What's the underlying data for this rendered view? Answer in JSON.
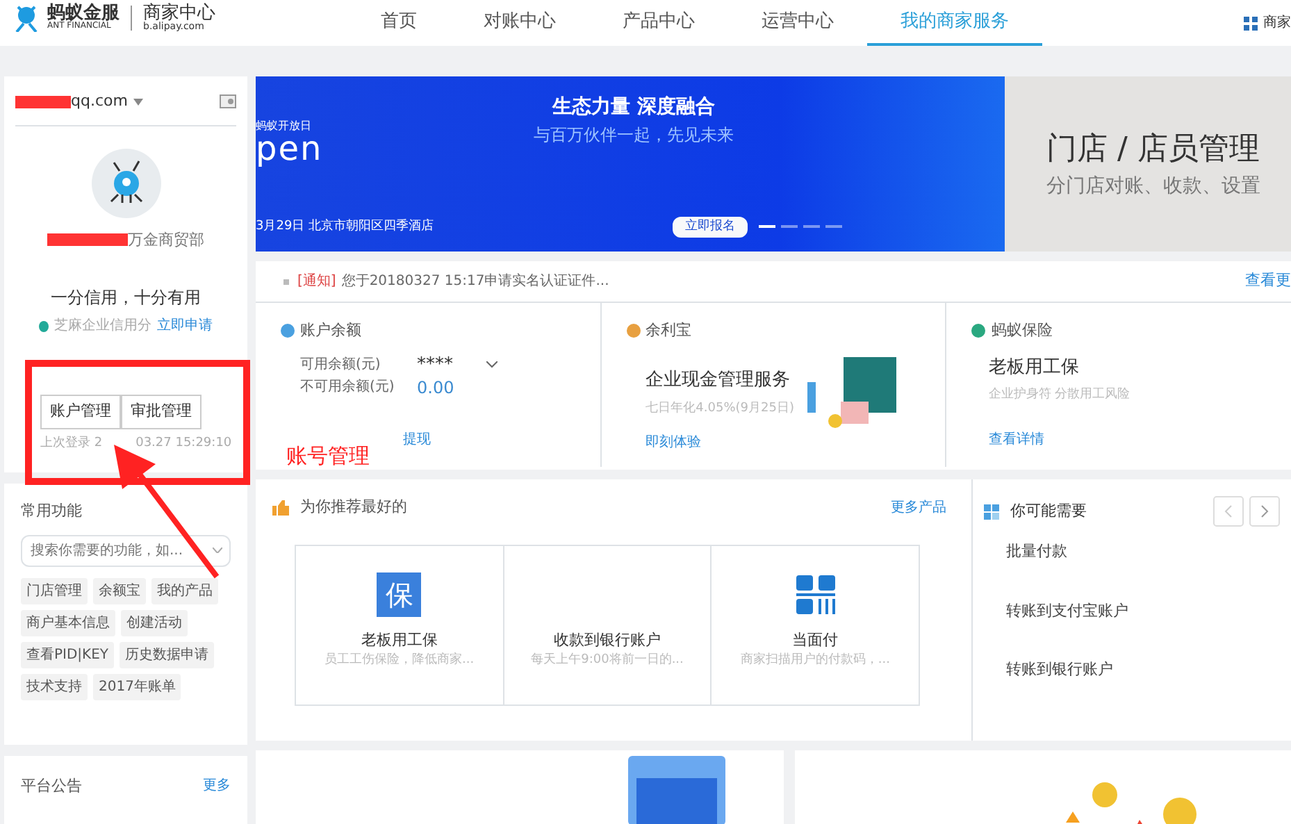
{
  "header": {
    "brand_cn": "蚂蚁金服",
    "brand_en": "ANT FINANCIAL",
    "center_cn": "商家中心",
    "center_url": "b.alipay.com",
    "nav": [
      {
        "label": "首页",
        "selected": false
      },
      {
        "label": "对账中心",
        "selected": false
      },
      {
        "label": "产品中心",
        "selected": false
      },
      {
        "label": "运营中心",
        "selected": false
      },
      {
        "label": "我的商家服务",
        "selected": true
      }
    ],
    "right_label": "商家"
  },
  "account": {
    "email": "qq.com",
    "name": "万金商贸部",
    "slogan": "一分信用，十分有用",
    "credit_label": "芝麻企业信用分",
    "credit_link": "立即申请",
    "buttons": [
      "账户管理",
      "审批管理"
    ],
    "last_login": [
      "上次登录 2",
      "03.27 15:29:10"
    ]
  },
  "functions": {
    "title": "常用功能",
    "placeholder": "搜索你需要的功能，如...",
    "tags": [
      "门店管理",
      "余额宝",
      "我的产品",
      "商户基本信息",
      "创建活动",
      "查看PID|KEY",
      "历史数据申请",
      "技术支持",
      "2017年账单"
    ]
  },
  "announcements": {
    "title": "平台公告",
    "more": "更多"
  },
  "banner": {
    "brand": "蚂蚁开放日",
    "logo": "pen",
    "title": "生态力量 深度融合",
    "subtitle": "与百万伙伴一起，先见未来",
    "venue": "3月29日  北京市朝阳区四季酒店",
    "button": "立即报名",
    "dots": [
      {
        "selected": true
      },
      {
        "selected": false
      },
      {
        "selected": false
      },
      {
        "selected": false
      }
    ]
  },
  "side_banner": {
    "title": "门店 / 店员管理",
    "subtitle": "分门店对账、收款、设置"
  },
  "notice": {
    "tag": "[通知]",
    "text": "您于20180327 15:17申请实名认证证件...",
    "link": "查看更"
  },
  "info_cards": [
    {
      "kind": "balance",
      "title": "账户余额",
      "rows": [
        {
          "label": "可用余额(元)",
          "value": "****"
        },
        {
          "label": "不可用余额(元)",
          "value": "0.00"
        }
      ],
      "link": "提现"
    },
    {
      "kind": "promo",
      "title": "余利宝",
      "heading": "企业现金管理服务",
      "sub": "七日年化4.05%(9月25日)",
      "link": "即刻体验"
    },
    {
      "kind": "insurance",
      "title": "蚂蚁保险",
      "heading": "老板用工保",
      "sub": "企业护身符 分散用工风险",
      "link": "查看详情"
    }
  ],
  "recommend": {
    "title": "为你推荐最好的",
    "more": "更多产品",
    "items": [
      {
        "kind": "char",
        "char": "保",
        "name": "老板用工保",
        "desc": "员工工伤保险，降低商家..."
      },
      {
        "kind": "none",
        "name": "收款到银行账户",
        "desc": "每天上午9:00将前一日的..."
      },
      {
        "kind": "grid",
        "name": "当面付",
        "desc": "商家扫描用户的付款码，..."
      }
    ]
  },
  "needs": {
    "title": "你可能需要",
    "items": [
      "批量付款",
      "转账到支付宝账户",
      "转账到银行账户"
    ]
  },
  "annotation": {
    "label": "账号管理"
  }
}
